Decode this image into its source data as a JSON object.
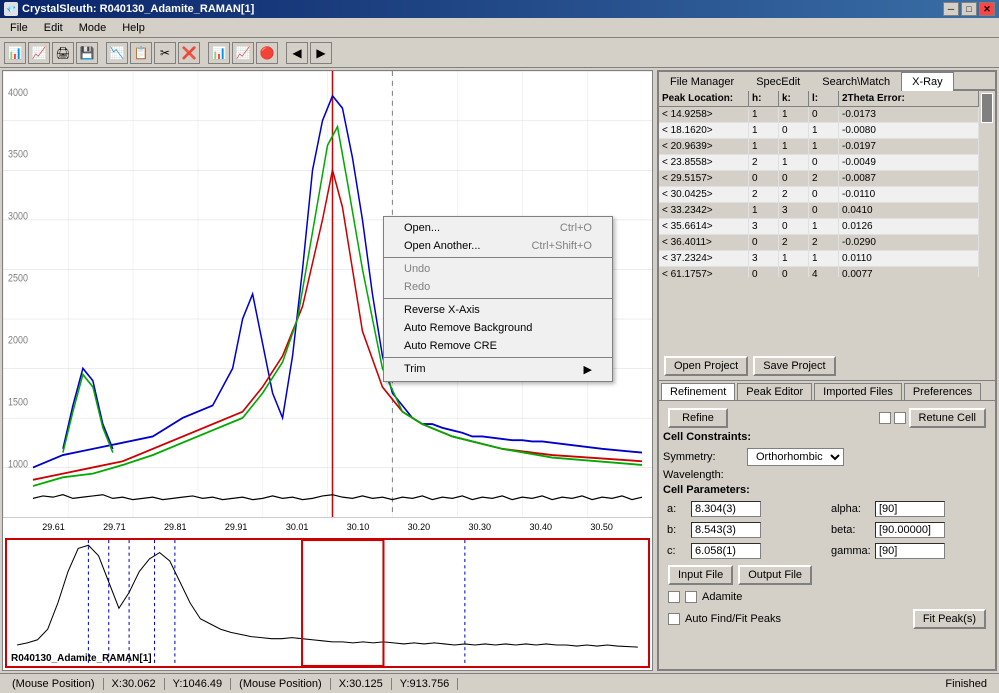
{
  "app": {
    "title": "CrystalSleuth: R040130_Adamite_RAMAN[1]",
    "icon": "💎"
  },
  "titlebar": {
    "minimize": "─",
    "maximize": "□",
    "close": "✕"
  },
  "menu": {
    "items": [
      "File",
      "Edit",
      "Mode",
      "Help"
    ]
  },
  "tabs": {
    "main": [
      "File Manager",
      "SpecEdit",
      "Search\\Match",
      "X-Ray"
    ],
    "active_main": "X-Ray",
    "sub": [
      "Refinement",
      "Peak Editor",
      "Imported Files",
      "Preferences"
    ],
    "active_sub": "Refinement"
  },
  "xray_table": {
    "headers": [
      "Peak Location:",
      "h:",
      "k:",
      "l:",
      "2Theta Error:"
    ],
    "rows": [
      [
        "< 14.9258>",
        "1",
        "1",
        "0",
        "-0.0173"
      ],
      [
        "< 18.1620>",
        "1",
        "0",
        "1",
        "-0.0080"
      ],
      [
        "< 20.9639>",
        "1",
        "1",
        "1",
        "-0.0197"
      ],
      [
        "< 23.8558>",
        "2",
        "1",
        "0",
        "-0.0049"
      ],
      [
        "< 29.5157>",
        "0",
        "0",
        "2",
        "-0.0087"
      ],
      [
        "< 30.0425>",
        "2",
        "2",
        "0",
        "-0.0110"
      ],
      [
        "< 33.2342>",
        "1",
        "3",
        "0",
        "0.0410"
      ],
      [
        "< 35.6614>",
        "3",
        "0",
        "1",
        "0.0126"
      ],
      [
        "< 36.4011>",
        "0",
        "2",
        "2",
        "-0.0290"
      ],
      [
        "< 37.2324>",
        "3",
        "1",
        "1",
        "0.0110"
      ],
      [
        "< 61.1757>",
        "0",
        "0",
        "4",
        "0.0077"
      ]
    ]
  },
  "project_buttons": {
    "open": "Open Project",
    "save": "Save Project"
  },
  "refinement": {
    "refine_btn": "Refine",
    "retune_btn": "Retune Cell",
    "cell_constraints_label": "Cell Constraints:",
    "symmetry_label": "Symmetry:",
    "symmetry_value": "Orthorhombic",
    "wavelength_label": "Wavelength:",
    "cell_params_label": "Cell Parameters:",
    "a_label": "a:",
    "a_value": "8.304(3)",
    "b_label": "b:",
    "b_value": "8.543(3)",
    "c_label": "c:",
    "c_value": "6.058(1)",
    "alpha_label": "alpha:",
    "alpha_value": "[90]",
    "beta_label": "beta:",
    "beta_value": "[90.00000]",
    "gamma_label": "gamma:",
    "gamma_value": "[90]",
    "input_file_btn": "Input File",
    "output_file_btn": "Output File",
    "mineral_name": "Adamite",
    "auto_find_label": "Auto Find/Fit Peaks",
    "fit_peaks_btn": "Fit Peak(s)"
  },
  "context_menu": {
    "items": [
      {
        "label": "Open...",
        "shortcut": "Ctrl+O",
        "disabled": false
      },
      {
        "label": "Open Another...",
        "shortcut": "Ctrl+Shift+O",
        "disabled": false
      },
      {
        "separator": true
      },
      {
        "label": "Undo",
        "shortcut": "",
        "disabled": true
      },
      {
        "label": "Redo",
        "shortcut": "",
        "disabled": true
      },
      {
        "separator": true
      },
      {
        "label": "Reverse X-Axis",
        "shortcut": "",
        "disabled": false
      },
      {
        "label": "Auto Remove Background",
        "shortcut": "",
        "disabled": false
      },
      {
        "label": "Auto Remove CRE",
        "shortcut": "",
        "disabled": false
      },
      {
        "separator": true
      },
      {
        "label": "Trim",
        "shortcut": "",
        "disabled": false,
        "arrow": true
      }
    ]
  },
  "x_axis": {
    "labels": [
      "29.61",
      "29.71",
      "29.81",
      "29.91",
      "30.01",
      "30.10",
      "30.20",
      "30.30",
      "30.40",
      "30.50"
    ]
  },
  "chart_bottom": {
    "label": "R040130_Adamite_RAMAN[1]"
  },
  "status": {
    "pos1_label": "(Mouse Position)",
    "pos1_x": "X:30.062",
    "pos1_y": "Y:1046.49",
    "pos2_label": "(Mouse Position)",
    "pos2_x": "X:30.125",
    "pos2_y": "Y:913.756",
    "finished": "Finished"
  },
  "colors": {
    "accent_blue": "#0a246a",
    "border": "#808080",
    "bg": "#d4d0c8",
    "red_line": "#cc0000",
    "green_line": "#00aa00",
    "blue_line": "#0000cc",
    "black_line": "#000000"
  }
}
